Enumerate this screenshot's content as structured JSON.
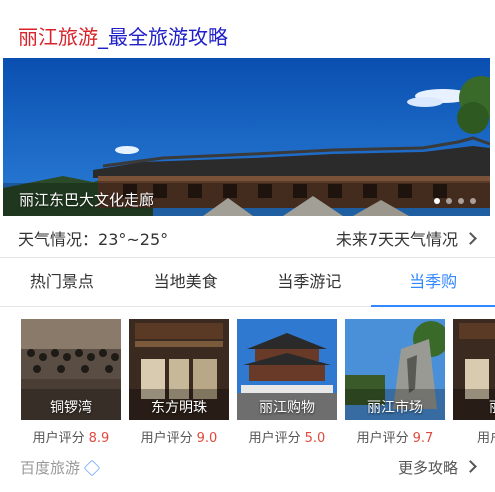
{
  "header": {
    "title_red": "丽江旅游",
    "title_blue": "_最全旅游攻略"
  },
  "banner": {
    "caption": "丽江东巴大文化走廊",
    "slide_count": 4,
    "active_slide": 1
  },
  "weather": {
    "label": "天气情况：",
    "range": "23°~25°",
    "forecast_link": "未来7天天气情况"
  },
  "tabs": [
    {
      "label": "热门景点",
      "active": false
    },
    {
      "label": "当地美食",
      "active": false
    },
    {
      "label": "当季游记",
      "active": false
    },
    {
      "label": "当季购",
      "active": true
    }
  ],
  "score_label": "用户评分",
  "cards": [
    {
      "name": "铜锣湾",
      "score": "8.9"
    },
    {
      "name": "东方明珠",
      "score": "9.0"
    },
    {
      "name": "丽江购物",
      "score": "5.0"
    },
    {
      "name": "丽江市场",
      "score": "9.7"
    },
    {
      "name": "丽江",
      "score": ""
    }
  ],
  "footer": {
    "brand": "百度旅游",
    "more": "更多攻略"
  },
  "colors": {
    "accent": "#3388ff",
    "title_red": "#d8232a",
    "title_blue": "#2020c8",
    "score": "#e04a3c"
  }
}
